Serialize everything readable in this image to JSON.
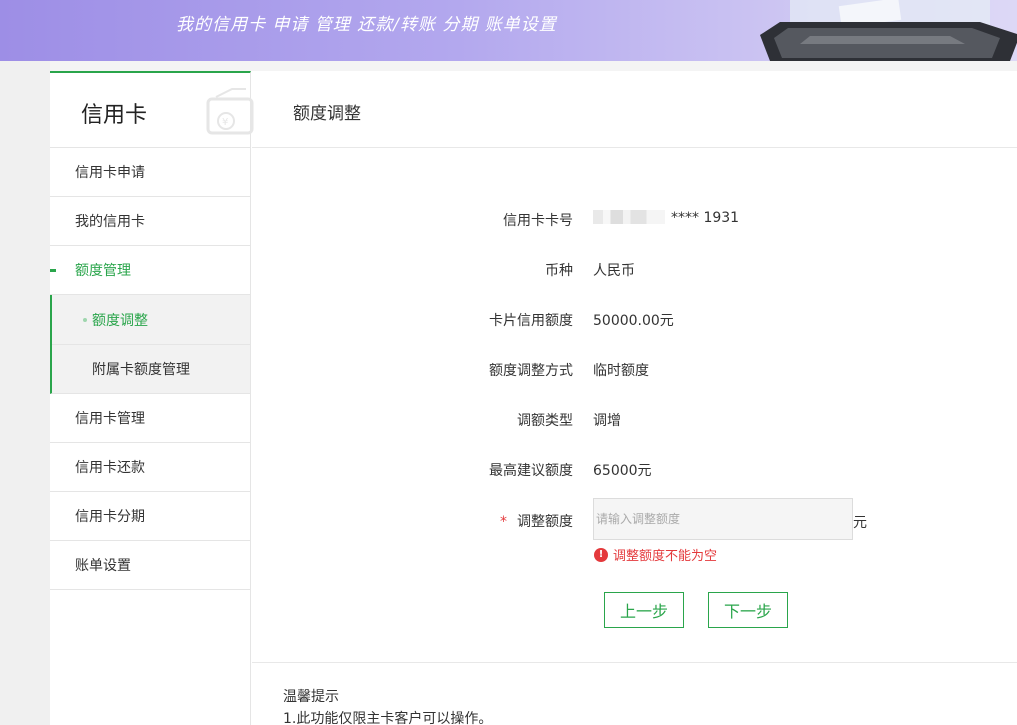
{
  "banner": {
    "slogan": "我的信用卡  申请 管理  还款/转账  分期  账单设置"
  },
  "sidebar": {
    "title": "信用卡",
    "items": [
      {
        "label": "信用卡申请"
      },
      {
        "label": "我的信用卡"
      },
      {
        "label": "额度管理",
        "active": true
      },
      {
        "label": "信用卡管理"
      },
      {
        "label": "信用卡还款"
      },
      {
        "label": "信用卡分期"
      },
      {
        "label": "账单设置"
      }
    ],
    "subitems": [
      {
        "label": "额度调整",
        "active": true
      },
      {
        "label": "附属卡额度管理"
      }
    ]
  },
  "main": {
    "title": "额度调整",
    "fields": [
      {
        "label": "信用卡卡号",
        "value": "**** 1931"
      },
      {
        "label": "币种",
        "value": "人民币"
      },
      {
        "label": "卡片信用额度",
        "value": "50000.00元"
      },
      {
        "label": "额度调整方式",
        "value": "临时额度"
      },
      {
        "label": "调额类型",
        "value": "调增"
      },
      {
        "label": "最高建议额度",
        "value": "65000元"
      }
    ],
    "adjust": {
      "required_mark": "*",
      "label": "调整额度",
      "value": "",
      "placeholder": "请输入调整额度",
      "unit": "元",
      "error": "调整额度不能为空"
    },
    "buttons": {
      "prev": "上一步",
      "next": "下一步"
    },
    "tips": {
      "title": "温馨提示",
      "line1": "1.此功能仅限主卡客户可以操作。"
    }
  },
  "colors": {
    "accent": "#2aa54b",
    "error": "#e4393c",
    "banner": "#a99cea"
  }
}
